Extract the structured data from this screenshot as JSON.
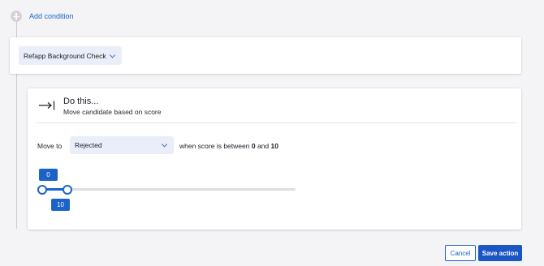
{
  "add_condition": {
    "label": "Add condition",
    "icon": "plus-circle-icon"
  },
  "condition": {
    "selected": "Refapp Background Check"
  },
  "action": {
    "title": "Do this...",
    "subtitle": "Move candidate based on score",
    "move_to_label": "Move to",
    "status_selected": "Rejected",
    "score_prefix": "when score is between",
    "score_min": "0",
    "score_and": "and",
    "score_max": "10"
  },
  "slider": {
    "min_value": "0",
    "max_value": "10"
  },
  "footer": {
    "cancel_label": "Cancel",
    "save_label": "Save action"
  },
  "colors": {
    "accent": "#1a63c9",
    "select_bg": "#e9eef8",
    "background": "#f4f4f6"
  }
}
